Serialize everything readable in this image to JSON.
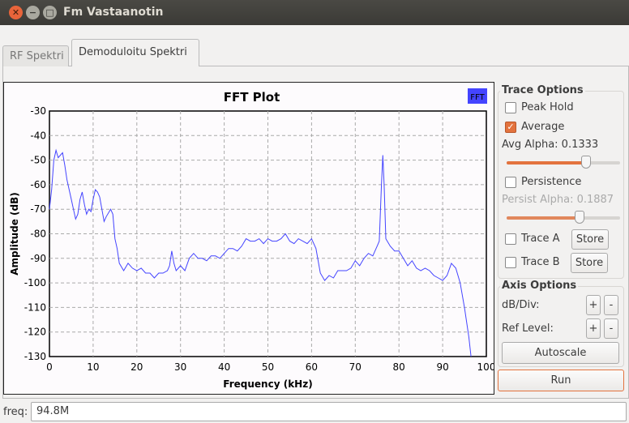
{
  "window": {
    "title": "Fm Vastaanotin"
  },
  "tabs": [
    {
      "label": "RF Spektri"
    },
    {
      "label": "Demoduloitu Spektri"
    }
  ],
  "plot": {
    "legend": "FFT",
    "legend_color": "#4444ff"
  },
  "trace_options": {
    "title": "Trace Options",
    "peak_hold": "Peak Hold",
    "peak_hold_checked": false,
    "average": "Average",
    "average_checked": true,
    "avg_alpha_label": "Avg Alpha: 0.1333",
    "avg_alpha": 0.1333,
    "persistence": "Persistence",
    "persistence_checked": false,
    "persist_alpha_label": "Persist Alpha: 0.1887",
    "persist_alpha": 0.1887,
    "trace_a": "Trace A",
    "trace_b": "Trace B",
    "store": "Store"
  },
  "axis_options": {
    "title": "Axis Options",
    "db_div": "dB/Div:",
    "ref_level": "Ref Level:",
    "plus": "+",
    "minus": "-",
    "autoscale": "Autoscale"
  },
  "run": "Run",
  "freq": {
    "label": "freq:",
    "value": "94.8M"
  },
  "chart_data": {
    "type": "line",
    "title": "FFT Plot",
    "xlabel": "Frequency (kHz)",
    "ylabel": "Amplitude (dB)",
    "xlim": [
      0,
      100
    ],
    "ylim": [
      -130,
      -30
    ],
    "grid": true,
    "legend": "top-right",
    "xticks": [
      0,
      10,
      20,
      30,
      40,
      50,
      60,
      70,
      80,
      90,
      100
    ],
    "yticks": [
      -30,
      -40,
      -50,
      -60,
      -70,
      -80,
      -90,
      -100,
      -110,
      -120,
      -130
    ],
    "series": [
      {
        "name": "FFT",
        "color": "#4444ff",
        "x": [
          0,
          0.5,
          1,
          1.5,
          2,
          2.5,
          3,
          3.5,
          4,
          4.5,
          5,
          5.5,
          6,
          6.5,
          7,
          7.5,
          8,
          8.5,
          9,
          9.5,
          10,
          10.5,
          11,
          11.5,
          12,
          12.5,
          13,
          14,
          14.5,
          15,
          15.5,
          16,
          17,
          18,
          19,
          20,
          21,
          22,
          23,
          24,
          25,
          26,
          27,
          27.5,
          28,
          28.5,
          29,
          30,
          31,
          32,
          33,
          34,
          35,
          36,
          37,
          38,
          39,
          40,
          41,
          42,
          43,
          44,
          45,
          46,
          47,
          48,
          49,
          50,
          51,
          52,
          53,
          54,
          55,
          56,
          57,
          58,
          59,
          60,
          61,
          62,
          63,
          64,
          65,
          66,
          67,
          68,
          69,
          70,
          71,
          72,
          73,
          74,
          75,
          75.5,
          76,
          76.3,
          76.6,
          77,
          78,
          79,
          80,
          81,
          82,
          83,
          84,
          85,
          86,
          87,
          88,
          89,
          90,
          91,
          92,
          93,
          94,
          95,
          96,
          96.5
        ],
        "y": [
          -70,
          -62,
          -50,
          -46,
          -49,
          -48,
          -47,
          -52,
          -58,
          -62,
          -66,
          -70,
          -74,
          -72,
          -66,
          -63,
          -68,
          -72,
          -70,
          -71,
          -66,
          -62,
          -63,
          -65,
          -70,
          -75,
          -73,
          -70,
          -72,
          -82,
          -86,
          -92,
          -95,
          -92,
          -94,
          -95,
          -94,
          -96,
          -96,
          -98,
          -96,
          -96,
          -95,
          -93,
          -87,
          -92,
          -95,
          -93,
          -95,
          -90,
          -88,
          -90,
          -90,
          -91,
          -89,
          -89,
          -90,
          -88,
          -86,
          -86,
          -87,
          -85,
          -82,
          -83,
          -83,
          -82,
          -84,
          -82,
          -83,
          -83,
          -82,
          -80,
          -83,
          -84,
          -82,
          -83,
          -84,
          -82,
          -86,
          -96,
          -99,
          -97,
          -98,
          -95,
          -95,
          -95,
          -94,
          -91,
          -93,
          -90,
          -88,
          -89,
          -85,
          -83,
          -60,
          -48,
          -60,
          -82,
          -85,
          -87,
          -87,
          -90,
          -93,
          -91,
          -94,
          -95,
          -94,
          -95,
          -97,
          -98,
          -99,
          -97,
          -92,
          -94,
          -100,
          -110,
          -122,
          -130
        ]
      }
    ]
  }
}
